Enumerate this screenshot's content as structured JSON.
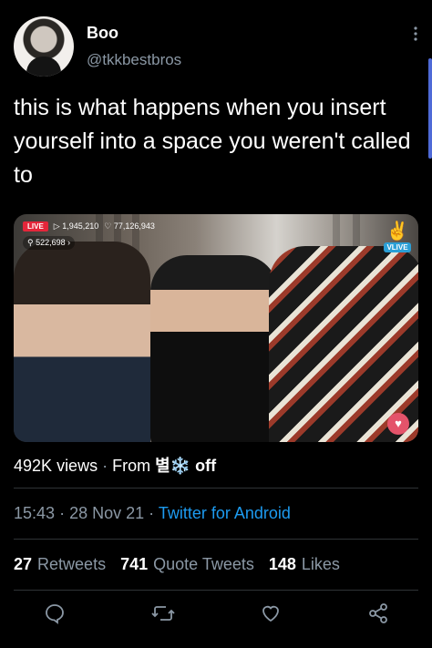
{
  "tweet": {
    "author_name": "Boo",
    "author_handle": "@tkkbestbros",
    "more_icon": "more-vertical-icon",
    "text": "this is what happens when you insert yourself into a space you weren't called to"
  },
  "media": {
    "live_label": "LIVE",
    "play_count": "▷ 1,945,210",
    "heart_count": "♡ 77,126,943",
    "viewers": "⚲ 522,698 ›",
    "brand_label": "VLIVE"
  },
  "meta": {
    "views_count": "492K",
    "views_label": "views",
    "from_label": "From",
    "source_name": "별❄️",
    "source_suffix": "off",
    "time": "15:43",
    "date": "28 Nov 21",
    "client": "Twitter for Android"
  },
  "stats": {
    "retweets_count": "27",
    "retweets_label": "Retweets",
    "quotes_count": "741",
    "quotes_label": "Quote Tweets",
    "likes_count": "148",
    "likes_label": "Likes"
  },
  "actions": {
    "reply_icon": "reply-icon",
    "retweet_icon": "retweet-icon",
    "like_icon": "heart-icon",
    "share_icon": "share-icon"
  },
  "colors": {
    "background": "#000000",
    "text": "#e7e9ea",
    "secondary": "#8b98a5",
    "link": "#1d9bf0",
    "divider": "#2f3336"
  }
}
